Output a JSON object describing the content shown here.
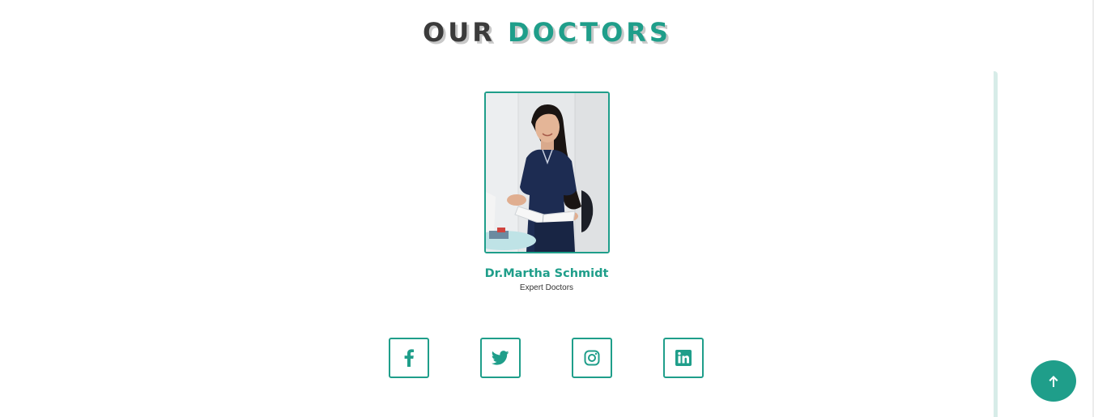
{
  "section": {
    "title_part1": "OUR",
    "title_part2": "DOCTORS"
  },
  "doctor": {
    "name": "Dr.Martha Schmidt",
    "role": "Expert Doctors",
    "photo_alt": "Dr.Martha Schmidt"
  },
  "socials": [
    {
      "icon": "facebook-icon"
    },
    {
      "icon": "twitter-icon"
    },
    {
      "icon": "instagram-icon"
    },
    {
      "icon": "linkedin-icon"
    }
  ],
  "back_to_top": {
    "icon": "arrow-up-icon"
  },
  "colors": {
    "accent": "#1f9e8a",
    "title_dark": "#3b3b3b",
    "title_shadow": "#c8c8c8",
    "rule": "#d7ece8"
  }
}
